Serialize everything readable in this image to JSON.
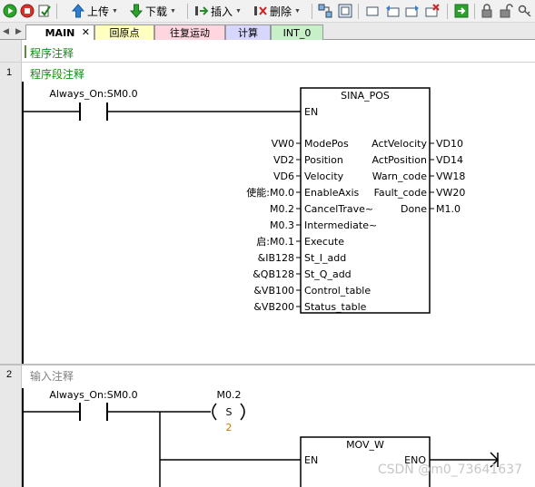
{
  "toolbar": {
    "upload_label": "上传",
    "download_label": "下载",
    "insert_label": "插入",
    "delete_label": "删除"
  },
  "tabs": [
    {
      "label": "MAIN",
      "color": "#ffffff",
      "active": true
    },
    {
      "label": "回原点",
      "color": "#ffffc0"
    },
    {
      "label": "往复运动",
      "color": "#ffd6e0"
    },
    {
      "label": "计算",
      "color": "#d6d6ff"
    },
    {
      "label": "INT_0",
      "color": "#c8f0c8"
    }
  ],
  "program_comment": "程序注释",
  "networks": [
    {
      "number": "1",
      "comment": "程序段注释",
      "contact": "Always_On:SM0.0",
      "block": {
        "name": "SINA_POS",
        "en": "EN",
        "inputs": [
          {
            "pin": "ModePos",
            "operand": "VW0"
          },
          {
            "pin": "Position",
            "operand": "VD2"
          },
          {
            "pin": "Velocity",
            "operand": "VD6"
          },
          {
            "pin": "EnableAxis",
            "operand": "使能:M0.0"
          },
          {
            "pin": "CancelTrave~",
            "operand": "M0.2"
          },
          {
            "pin": "Intermediate~",
            "operand": "M0.3"
          },
          {
            "pin": "Execute",
            "operand": "启:M0.1"
          },
          {
            "pin": "St_I_add",
            "operand": "&IB128"
          },
          {
            "pin": "St_Q_add",
            "operand": "&QB128"
          },
          {
            "pin": "Control_table",
            "operand": "&VB100"
          },
          {
            "pin": "Status_table",
            "operand": "&VB200"
          }
        ],
        "outputs": [
          {
            "pin": "ActVelocity",
            "operand": "VD10"
          },
          {
            "pin": "ActPosition",
            "operand": "VD14"
          },
          {
            "pin": "Warn_code",
            "operand": "VW18"
          },
          {
            "pin": "Fault_code",
            "operand": "VW20"
          },
          {
            "pin": "Done",
            "operand": "M1.0"
          }
        ]
      }
    },
    {
      "number": "2",
      "comment": "输入注释",
      "contact": "Always_On:SM0.0",
      "coil": {
        "operand": "M0.2",
        "type": "S",
        "count": "2"
      },
      "block": {
        "name": "MOV_W",
        "en": "EN",
        "eno": "ENO"
      }
    }
  ],
  "watermark": "CSDN @m0_73641637",
  "colors": {
    "comment_green": "#138a13",
    "comment_gray": "#808080",
    "count_orange": "#c08000"
  }
}
